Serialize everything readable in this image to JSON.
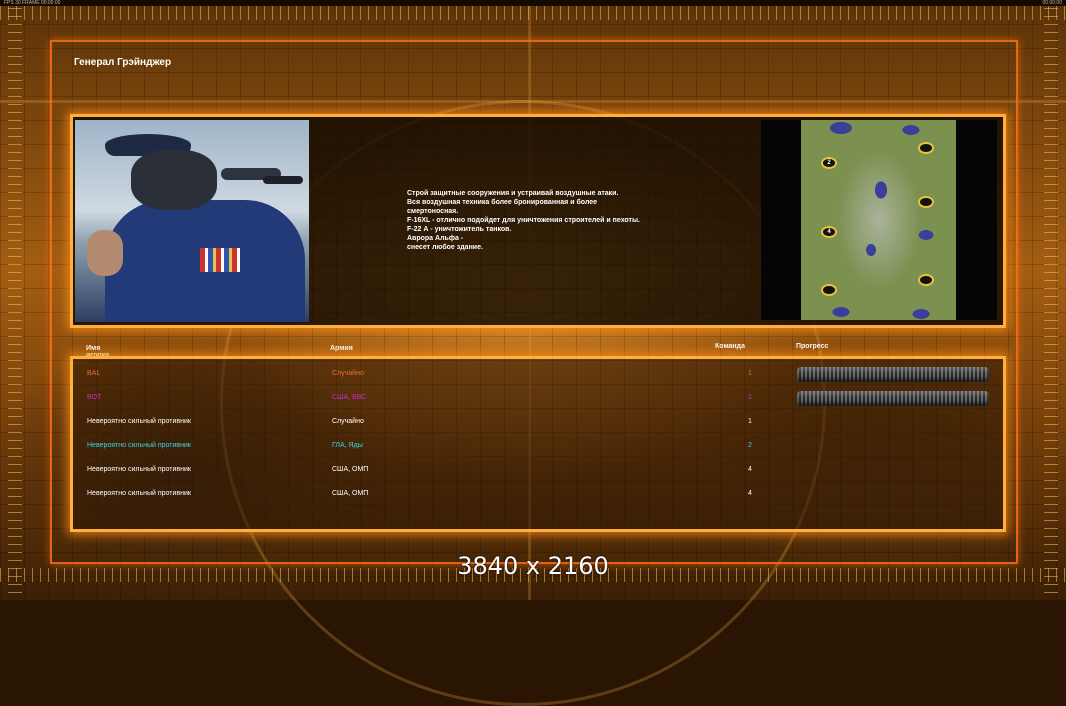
{
  "status_bar": {
    "left_text": "FPS 30 FRAME 00:00:00",
    "clock": "00:00:00"
  },
  "title": "Генерал Грэйнджер",
  "briefing": {
    "description_lines": [
      "Строй защитные сооружения и устраивай воздушные атаки.",
      "Вся воздушная техника более бронированная и более",
      "смертоносная.",
      "F-16XL - отлично подойдет для уничтожения строителей и пехоты.",
      "F-22 А - уничтожитель танков.",
      "Аврора Альфа -",
      "снесет любое здание."
    ],
    "map_start_labels": [
      "2",
      "4"
    ]
  },
  "table": {
    "headers": {
      "player": "Имя игрока",
      "army": "Армия",
      "team": "Команда",
      "progress": "Прогресс"
    },
    "rows": [
      {
        "name": "BAL",
        "army": "Случайно",
        "team": "1",
        "color": "#e0703a",
        "show_progress": true
      },
      {
        "name": "BOT",
        "army": "США, ВВС",
        "team": "1",
        "color": "#c82ec8",
        "show_progress": true
      },
      {
        "name": "Невероятно сильный противник",
        "army": "Случайно",
        "team": "1",
        "color": "#ffffff",
        "show_progress": false
      },
      {
        "name": "Невероятно сильный противник",
        "army": "ГЛА, Яды",
        "team": "2",
        "color": "#3ad6e8",
        "show_progress": false
      },
      {
        "name": "Невероятно сильный противник",
        "army": "США, ОМП",
        "team": "4",
        "color": "#ffffff",
        "show_progress": false
      },
      {
        "name": "Невероятно сильный противник",
        "army": "США, ОМП",
        "team": "4",
        "color": "#ffffff",
        "show_progress": false
      }
    ]
  },
  "watermark": "3840 x 2160",
  "colors": {
    "frame_orange": "#ffb03b",
    "accent_red": "#ff6e14"
  }
}
